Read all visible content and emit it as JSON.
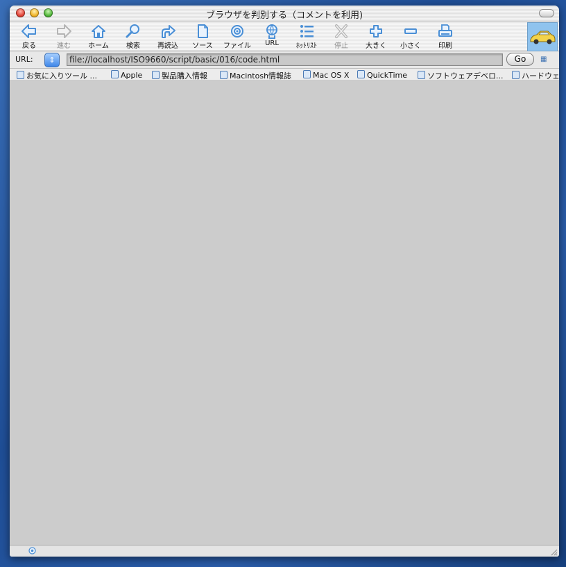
{
  "window": {
    "title": "ブラウザを判別する（コメントを利用)"
  },
  "toolbar": {
    "buttons": [
      {
        "label": "戻る",
        "icon": "back-arrow-icon"
      },
      {
        "label": "進む",
        "icon": "forward-arrow-icon",
        "disabled": true
      },
      {
        "label": "ホーム",
        "icon": "home-icon"
      },
      {
        "label": "検索",
        "icon": "search-icon"
      },
      {
        "label": "再読込",
        "icon": "reload-icon"
      },
      {
        "label": "ソース",
        "icon": "source-document-icon"
      },
      {
        "label": "ファイル",
        "icon": "file-target-icon"
      },
      {
        "label": "URL",
        "icon": "url-globe-icon"
      },
      {
        "label": "ﾎｯﾄﾘｽﾄ",
        "icon": "hotlist-icon"
      },
      {
        "label": "停止",
        "icon": "stop-icon",
        "disabled": true
      },
      {
        "label": "大きく",
        "icon": "plus-icon"
      },
      {
        "label": "小さく",
        "icon": "minus-icon"
      },
      {
        "label": "印刷",
        "icon": "print-icon"
      }
    ]
  },
  "address": {
    "label": "URL:",
    "value": "file://localhost/ISO9660/script/basic/016/code.html",
    "go_label": "Go"
  },
  "favorites": [
    "お気に入りツール ...",
    "Apple",
    "製品購入情報",
    "Macintosh情報誌",
    "Mac OS X",
    "QuickTime",
    "ソフトウェアデベロ...",
    "ハードウェ"
  ],
  "colors": {
    "accent": "#3f86e8",
    "icon_blue": "#4a8fd6",
    "content_bg": "#cccccc"
  }
}
